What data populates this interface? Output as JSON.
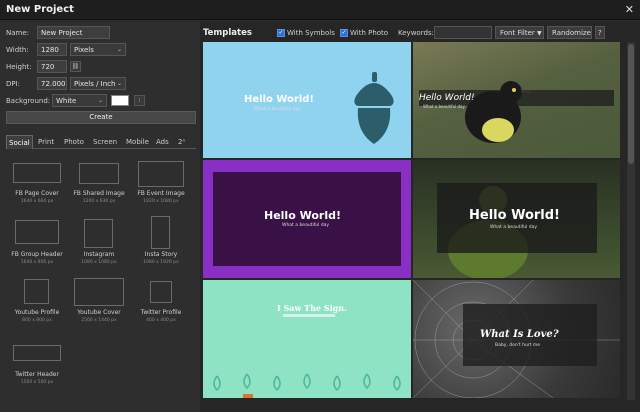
{
  "window": {
    "title": "New Project",
    "close_glyph": "✕"
  },
  "form": {
    "name_label": "Name:",
    "name_value": "New Project",
    "width_label": "Width:",
    "width_value": "1280",
    "width_unit": "Pixels",
    "height_label": "Height:",
    "height_value": "720",
    "dpi_label": "DPI:",
    "dpi_value": "72.000",
    "dpi_unit": "Pixels / Inch",
    "background_label": "Background:",
    "background_value": "White",
    "background_color": "#ffffff",
    "create_label": "Create"
  },
  "tabs": [
    "Social",
    "Print",
    "Photo",
    "Screen",
    "Mobile",
    "Ads",
    "2ⁿ"
  ],
  "presets": [
    {
      "name": "FB Page Cover",
      "size": "1640 x 664 px"
    },
    {
      "name": "FB Shared Image",
      "size": "1200 x 630 px"
    },
    {
      "name": "FB Event Image",
      "size": "1920 x 1080 px"
    },
    {
      "name": "FB Group Header",
      "size": "1640 x 856 px"
    },
    {
      "name": "Instagram",
      "size": "1080 x 1080 px"
    },
    {
      "name": "Insta Story",
      "size": "1080 x 1920 px"
    },
    {
      "name": "Youtube Profile",
      "size": "800 x 800 px"
    },
    {
      "name": "Youtube Cover",
      "size": "2560 x 1440 px"
    },
    {
      "name": "Twitter Profile",
      "size": "400 x 400 px"
    },
    {
      "name": "Twitter Header",
      "size": "1500 x 500 px"
    }
  ],
  "templates_bar": {
    "title": "Templates",
    "with_symbols": "With Symbols",
    "with_photo": "With Photo",
    "keywords_label": "Keywords:",
    "keywords_value": "",
    "font_filter": "Font Filter",
    "randomize": "Randomize",
    "help": "?"
  },
  "templates": [
    {
      "heading": "Hello World!",
      "sub": "What a beautiful day",
      "bg": "#8fd3ef"
    },
    {
      "heading": "Hello World!",
      "sub": "What a beautiful day",
      "bg": "#5a5a3a"
    },
    {
      "heading": "Hello World!",
      "sub": "What a beautiful day",
      "bg": "#8a2fc4"
    },
    {
      "heading": "Hello World!",
      "sub": "What a beautiful day",
      "bg": "#2d3320"
    },
    {
      "heading": "I Saw The Sign.",
      "sub": "",
      "bg": "#8fe3c5"
    },
    {
      "heading": "What Is Love?",
      "sub": "Baby, don't hurt me",
      "bg": "#3a3a3a"
    }
  ],
  "colors": {
    "accent": "#2f6fd6",
    "acorn": "#2b5d6b",
    "purple_inner": "#3a1146"
  }
}
